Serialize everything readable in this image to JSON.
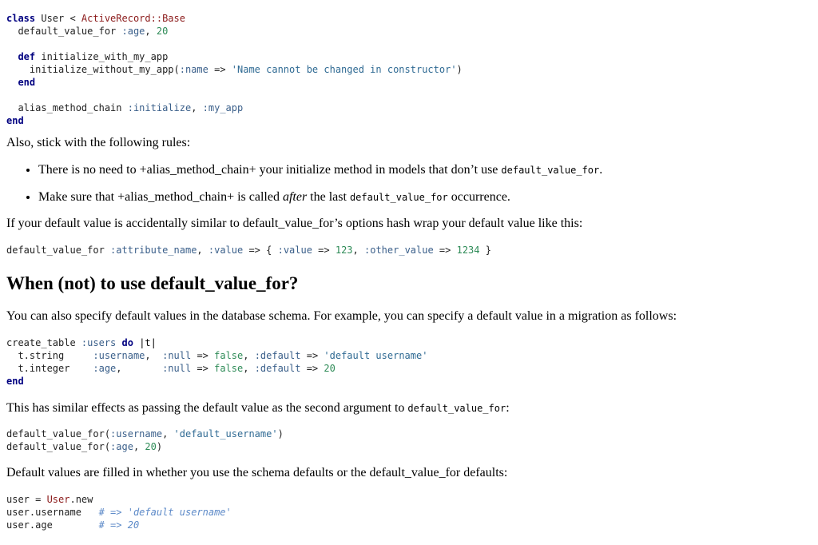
{
  "code1": {
    "lines": [
      [
        {
          "t": "class",
          "c": "kw"
        },
        {
          "t": " User < ",
          "c": ""
        },
        {
          "t": "ActiveRecord::Base",
          "c": "cls"
        }
      ],
      [
        {
          "t": "  default_value_for ",
          "c": ""
        },
        {
          "t": ":age",
          "c": "sym"
        },
        {
          "t": ", ",
          "c": ""
        },
        {
          "t": "20",
          "c": "num"
        }
      ],
      [
        {
          "t": "",
          "c": ""
        }
      ],
      [
        {
          "t": "  ",
          "c": ""
        },
        {
          "t": "def",
          "c": "kw"
        },
        {
          "t": " initialize_with_my_app",
          "c": ""
        }
      ],
      [
        {
          "t": "    initialize_without_my_app(",
          "c": ""
        },
        {
          "t": ":name",
          "c": "sym"
        },
        {
          "t": " => ",
          "c": ""
        },
        {
          "t": "'Name cannot be changed in constructor'",
          "c": "str"
        },
        {
          "t": ")",
          "c": ""
        }
      ],
      [
        {
          "t": "  ",
          "c": ""
        },
        {
          "t": "end",
          "c": "kw"
        }
      ],
      [
        {
          "t": "",
          "c": ""
        }
      ],
      [
        {
          "t": "  alias_method_chain ",
          "c": ""
        },
        {
          "t": ":initialize",
          "c": "sym"
        },
        {
          "t": ", ",
          "c": ""
        },
        {
          "t": ":my_app",
          "c": "sym"
        }
      ],
      [
        {
          "t": "end",
          "c": "kw"
        }
      ]
    ]
  },
  "para_rules_intro": "Also, stick with the following rules:",
  "rules": {
    "item1": {
      "text": "There is no need to +alias_method_chain+ your initialize method in models that don’t use ",
      "code": "default_value_for",
      "after": "."
    },
    "item2": {
      "before": "Make sure that +alias_method_chain+ is called ",
      "em": "after",
      "mid": " the last ",
      "code": "default_value_for",
      "after": " occurrence."
    }
  },
  "para_hash": "If your default value is accidentally similar to default_value_for’s options hash wrap your default value like this:",
  "code2": {
    "lines": [
      [
        {
          "t": "default_value_for ",
          "c": ""
        },
        {
          "t": ":attribute_name",
          "c": "sym"
        },
        {
          "t": ", ",
          "c": ""
        },
        {
          "t": ":value",
          "c": "sym"
        },
        {
          "t": " => { ",
          "c": ""
        },
        {
          "t": ":value",
          "c": "sym"
        },
        {
          "t": " => ",
          "c": ""
        },
        {
          "t": "123",
          "c": "num"
        },
        {
          "t": ", ",
          "c": ""
        },
        {
          "t": ":other_value",
          "c": "sym"
        },
        {
          "t": " => ",
          "c": ""
        },
        {
          "t": "1234",
          "c": "num"
        },
        {
          "t": " }",
          "c": ""
        }
      ]
    ]
  },
  "heading": "When (not) to use default_value_for?",
  "para_schema": "You can also specify default values in the database schema. For example, you can specify a default value in a migration as follows:",
  "code3": {
    "lines": [
      [
        {
          "t": "create_table ",
          "c": ""
        },
        {
          "t": ":users",
          "c": "sym"
        },
        {
          "t": " ",
          "c": ""
        },
        {
          "t": "do",
          "c": "kw"
        },
        {
          "t": " |t|",
          "c": "bar"
        }
      ],
      [
        {
          "t": "  t.string     ",
          "c": ""
        },
        {
          "t": ":username",
          "c": "sym"
        },
        {
          "t": ",  ",
          "c": ""
        },
        {
          "t": ":null",
          "c": "sym"
        },
        {
          "t": " => ",
          "c": ""
        },
        {
          "t": "false",
          "c": "num"
        },
        {
          "t": ", ",
          "c": ""
        },
        {
          "t": ":default",
          "c": "sym"
        },
        {
          "t": " => ",
          "c": ""
        },
        {
          "t": "'default username'",
          "c": "str"
        }
      ],
      [
        {
          "t": "  t.integer    ",
          "c": ""
        },
        {
          "t": ":age",
          "c": "sym"
        },
        {
          "t": ",       ",
          "c": ""
        },
        {
          "t": ":null",
          "c": "sym"
        },
        {
          "t": " => ",
          "c": ""
        },
        {
          "t": "false",
          "c": "num"
        },
        {
          "t": ", ",
          "c": ""
        },
        {
          "t": ":default",
          "c": "sym"
        },
        {
          "t": " => ",
          "c": ""
        },
        {
          "t": "20",
          "c": "num"
        }
      ],
      [
        {
          "t": "end",
          "c": "kw"
        }
      ]
    ]
  },
  "para_similar": {
    "text": "This has similar effects as passing the default value as the second argument to ",
    "code": "default_value_for",
    "after": ":"
  },
  "code4": {
    "lines": [
      [
        {
          "t": "default_value_for(",
          "c": ""
        },
        {
          "t": ":username",
          "c": "sym"
        },
        {
          "t": ", ",
          "c": ""
        },
        {
          "t": "'default_username'",
          "c": "str"
        },
        {
          "t": ")",
          "c": ""
        }
      ],
      [
        {
          "t": "default_value_for(",
          "c": ""
        },
        {
          "t": ":age",
          "c": "sym"
        },
        {
          "t": ", ",
          "c": ""
        },
        {
          "t": "20",
          "c": "num"
        },
        {
          "t": ")",
          "c": ""
        }
      ]
    ]
  },
  "para_filled": "Default values are filled in whether you use the schema defaults or the default_value_for defaults:",
  "code5": {
    "lines": [
      [
        {
          "t": "user = ",
          "c": ""
        },
        {
          "t": "User",
          "c": "cls"
        },
        {
          "t": ".new",
          "c": ""
        }
      ],
      [
        {
          "t": "user.username   ",
          "c": ""
        },
        {
          "t": "# => 'default username'",
          "c": "cmt"
        }
      ],
      [
        {
          "t": "user.age        ",
          "c": ""
        },
        {
          "t": "# => 20",
          "c": "cmt"
        }
      ]
    ]
  }
}
